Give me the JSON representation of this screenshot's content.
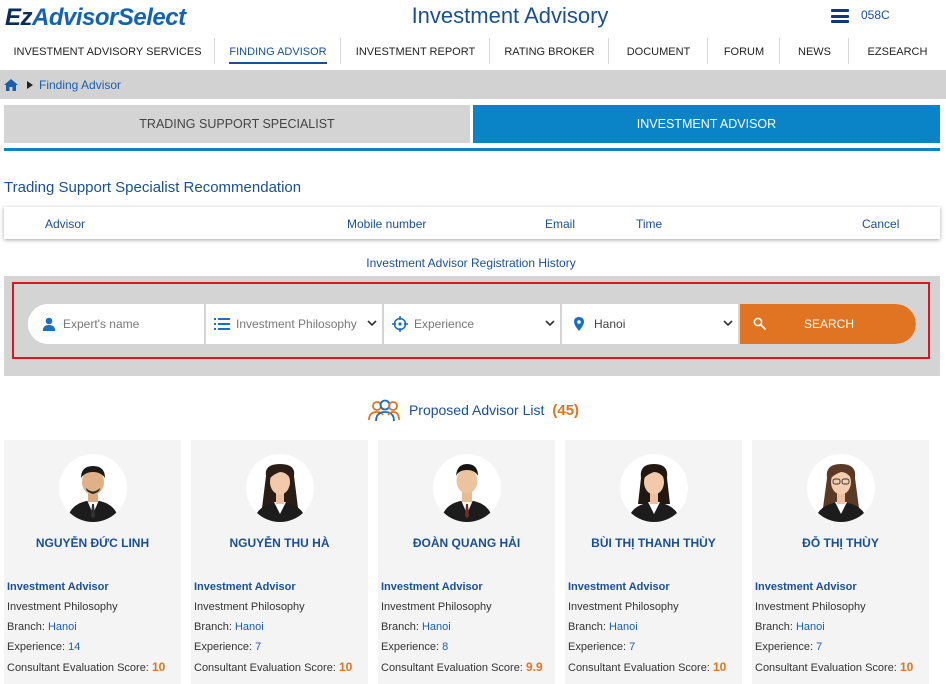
{
  "header": {
    "logo_ez": "Ez",
    "logo_rest": "AdvisorSelect",
    "site_title": "Investment Advisory",
    "user_code": "058C"
  },
  "nav": [
    "INVESTMENT ADVISORY SERVICES",
    "FINDING ADVISOR",
    "INVESTMENT REPORT",
    "RATING BROKER",
    "DOCUMENT",
    "FORUM",
    "NEWS",
    "EZSEARCH"
  ],
  "nav_active": "FINDING ADVISOR",
  "breadcrumb": {
    "current": "Finding Advisor"
  },
  "tabs": {
    "specialist": "TRADING SUPPORT SPECIALIST",
    "advisor": "INVESTMENT ADVISOR"
  },
  "recommendation": {
    "title": "Trading Support Specialist Recommendation",
    "columns": {
      "advisor": "Advisor",
      "mobile": "Mobile number",
      "email": "Email",
      "time": "Time",
      "cancel": "Cancel"
    }
  },
  "registration_history": "Investment Advisor Registration History",
  "search": {
    "name_placeholder": "Expert's name",
    "philosophy": "Investment Philosophy",
    "experience": "Experience",
    "location": "Hanoi",
    "button": "SEARCH"
  },
  "proposed": {
    "label": "Proposed Advisor List",
    "count": "(45)"
  },
  "card_labels": {
    "philosophy": "Investment Philosophy",
    "branch": "Branch:",
    "experience": "Experience:",
    "score": "Consultant Evaluation Score:"
  },
  "advisors": [
    {
      "name": "NGUYỄN ĐỨC LINH",
      "role": "Investment Advisor",
      "branch": "Hanoi",
      "experience": "14",
      "score": "10"
    },
    {
      "name": "NGUYỄN THU HÀ",
      "role": "Investment Advisor",
      "branch": "Hanoi",
      "experience": "7",
      "score": "10"
    },
    {
      "name": "ĐOÀN QUANG HẢI",
      "role": "Investment Advisor",
      "branch": "Hanoi",
      "experience": "8",
      "score": "9.9"
    },
    {
      "name": "BÙI THỊ THANH THÙY",
      "role": "Investment Advisor",
      "branch": "Hanoi",
      "experience": "7",
      "score": "10"
    },
    {
      "name": "ĐỖ THỊ THÙY",
      "role": "Investment Advisor",
      "branch": "Hanoi",
      "experience": "7",
      "score": "10"
    }
  ],
  "colors": {
    "brand": "#1a4f92",
    "accent": "#0a84c7",
    "orange": "#e07422",
    "highlight": "#e3121f"
  }
}
